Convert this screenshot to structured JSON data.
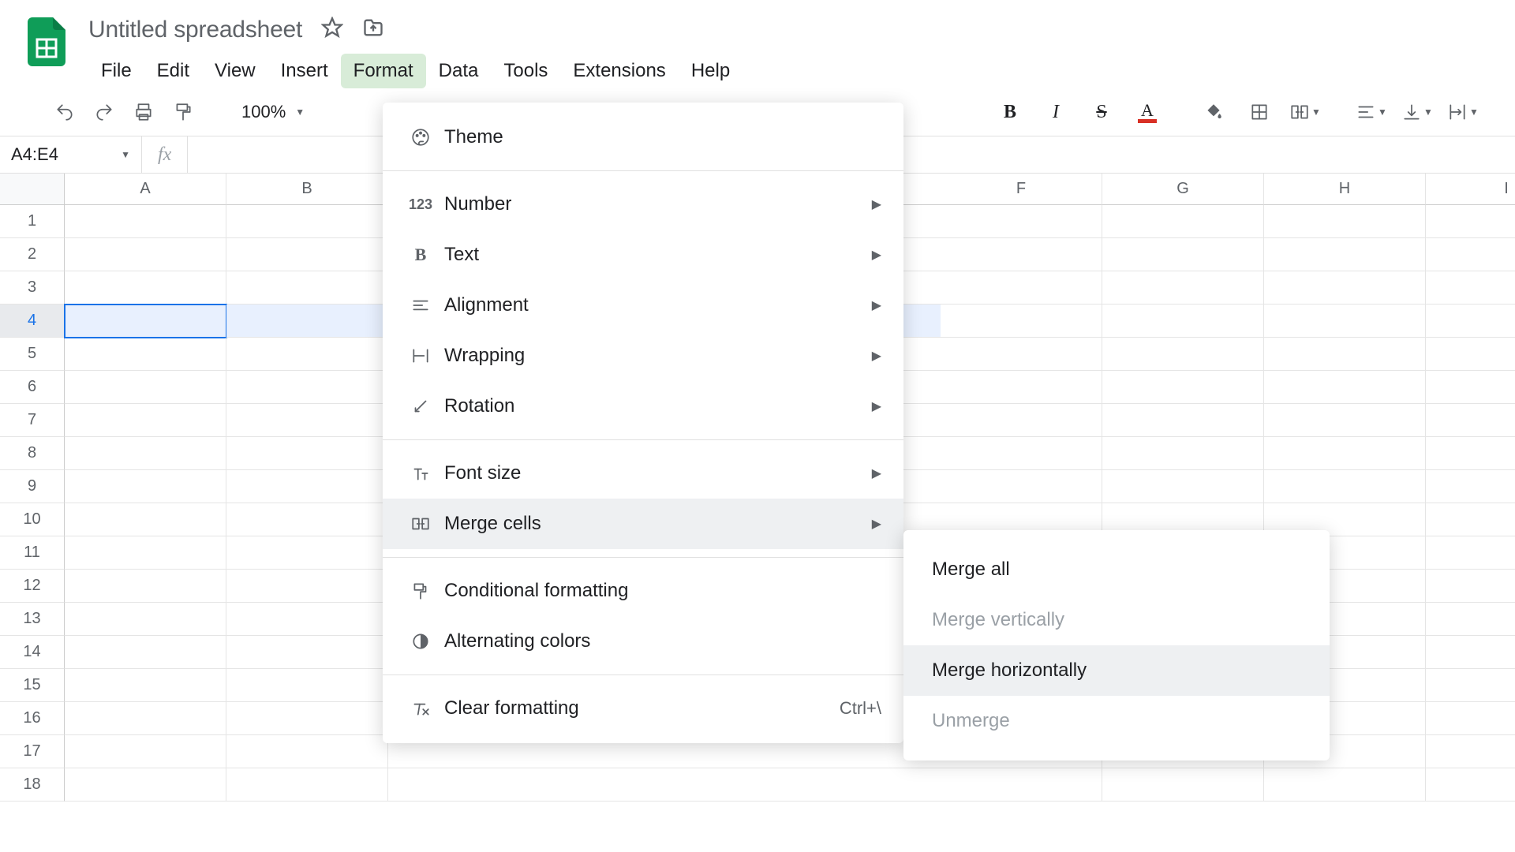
{
  "doc": {
    "title": "Untitled spreadsheet"
  },
  "menubar": {
    "file": "File",
    "edit": "Edit",
    "view": "View",
    "insert": "Insert",
    "format": "Format",
    "data": "Data",
    "tools": "Tools",
    "extensions": "Extensions",
    "help": "Help"
  },
  "toolbar": {
    "zoom": "100%"
  },
  "namebox": {
    "value": "A4:E4",
    "fx": "fx"
  },
  "columns": {
    "a": "A",
    "b": "B",
    "f": "F",
    "g": "G",
    "h": "H",
    "i": "I"
  },
  "rows": {
    "r1": "1",
    "r2": "2",
    "r3": "3",
    "r4": "4",
    "r5": "5",
    "r6": "6",
    "r7": "7",
    "r8": "8",
    "r9": "9",
    "r10": "10",
    "r11": "11",
    "r12": "12",
    "r13": "13",
    "r14": "14",
    "r15": "15",
    "r16": "16",
    "r17": "17",
    "r18": "18"
  },
  "format_menu": {
    "theme": "Theme",
    "number": "Number",
    "text": "Text",
    "alignment": "Alignment",
    "wrapping": "Wrapping",
    "rotation": "Rotation",
    "fontsize": "Font size",
    "merge": "Merge cells",
    "conditional": "Conditional formatting",
    "alternating": "Alternating colors",
    "clear": "Clear formatting",
    "clear_shortcut": "Ctrl+\\"
  },
  "merge_menu": {
    "all": "Merge all",
    "vert": "Merge vertically",
    "horiz": "Merge horizontally",
    "unmerge": "Unmerge"
  }
}
